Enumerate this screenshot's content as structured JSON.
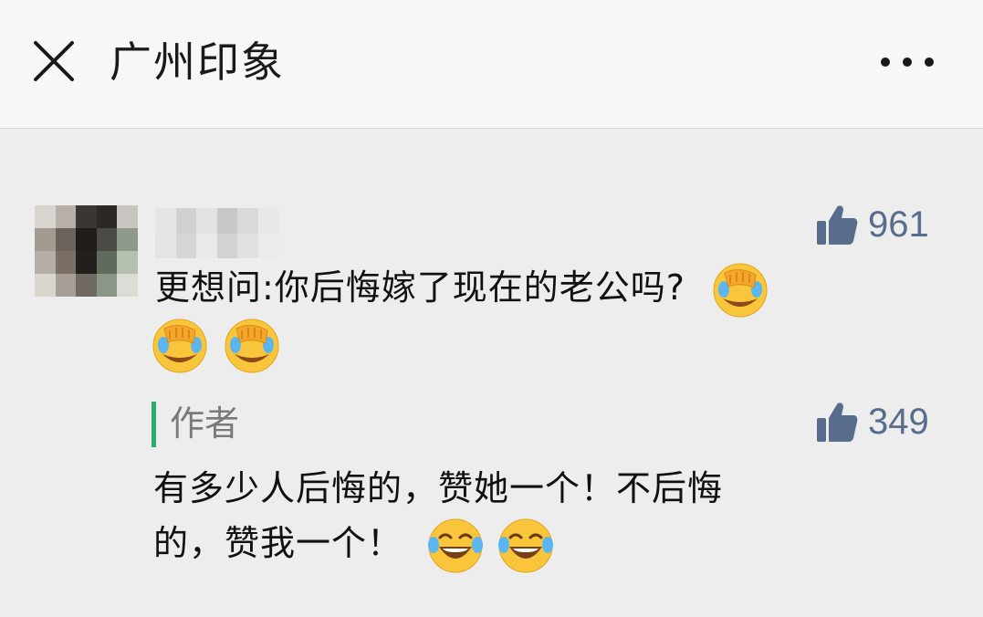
{
  "header": {
    "title": "广州印象"
  },
  "comment": {
    "text": "更想问:你后悔嫁了现在的老公吗?",
    "likes": "961",
    "trailing_emoji": "facepalm-tears",
    "emoji_line": [
      "facepalm-tears",
      "facepalm-tears"
    ]
  },
  "reply": {
    "label": "作者",
    "likes": "349",
    "line1": "有多少人后悔的，赞她一个！不后悔",
    "line2": "的，赞我一个！",
    "emojis": [
      "laughing-tears",
      "laughing-tears"
    ]
  },
  "colors": {
    "accent_green": "#2aae67",
    "like_blue": "#586c8c",
    "background": "#ededed",
    "header_bg": "#f7f7f7"
  }
}
